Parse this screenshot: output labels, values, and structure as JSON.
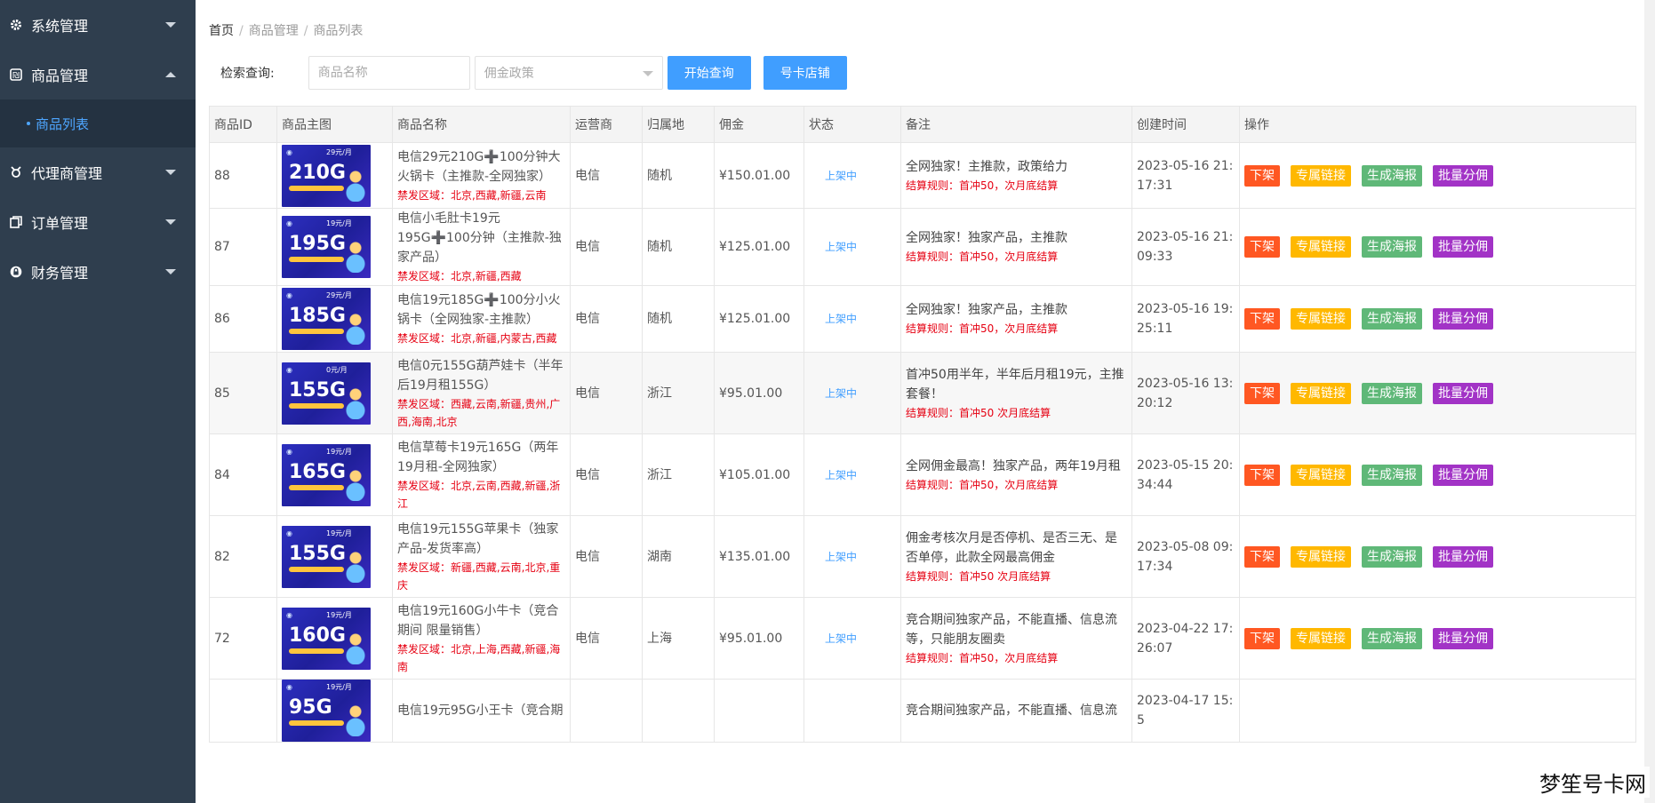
{
  "sidebar": {
    "items": [
      {
        "label": "系统管理",
        "icon": "gear-icon",
        "expanded": false
      },
      {
        "label": "商品管理",
        "icon": "goods-icon",
        "expanded": true
      },
      {
        "label": "代理商管理",
        "icon": "agent-icon",
        "expanded": false
      },
      {
        "label": "订单管理",
        "icon": "order-icon",
        "expanded": false
      },
      {
        "label": "财务管理",
        "icon": "lock-icon",
        "expanded": false
      }
    ],
    "sub_item": "商品列表"
  },
  "breadcrumb": [
    "首页",
    "商品管理",
    "商品列表"
  ],
  "search": {
    "label": "检索查询:",
    "name_placeholder": "商品名称",
    "policy_placeholder": "佣金政策",
    "query_button": "开始查询",
    "shop_button": "号卡店铺"
  },
  "table": {
    "headers": [
      "商品ID",
      "商品主图",
      "商品名称",
      "运营商",
      "归属地",
      "佣金",
      "状态",
      "备注",
      "创建时间",
      "操作"
    ],
    "actions": [
      "下架",
      "专属链接",
      "生成海报",
      "批量分佣"
    ],
    "rows": [
      {
        "id": "88",
        "img_big": "210G",
        "img_price": "29元/月",
        "name": "电信29元210G➕100分钟大火锅卡（主推款-全网独家）",
        "ban": "禁发区域：北京,西藏,新疆,云南",
        "operator": "电信",
        "region": "随机",
        "commission": "¥150.01.00",
        "status": "上架中",
        "remark": "全网独家！主推款，政策给力",
        "rule": "结算规则：首冲50，次月底结算",
        "time": "2023-05-16 21:17:31",
        "alt": false
      },
      {
        "id": "87",
        "img_big": "195G",
        "img_price": "19元/月",
        "name": "电信小毛肚卡19元195G➕100分钟（主推款-独家产品）",
        "ban": "禁发区域：北京,新疆,西藏",
        "operator": "电信",
        "region": "随机",
        "commission": "¥125.01.00",
        "status": "上架中",
        "remark": "全网独家！独家产品，主推款",
        "rule": "结算规则：首冲50，次月底结算",
        "time": "2023-05-16 21:09:33",
        "alt": false
      },
      {
        "id": "86",
        "img_big": "185G",
        "img_price": "29元/月",
        "name": "电信19元185G➕100分小火锅卡（全网独家-主推款）",
        "ban": "禁发区域：北京,新疆,内蒙古,西藏",
        "operator": "电信",
        "region": "随机",
        "commission": "¥125.01.00",
        "status": "上架中",
        "remark": "全网独家！独家产品，主推款",
        "rule": "结算规则：首冲50，次月底结算",
        "time": "2023-05-16 19:25:11",
        "alt": false
      },
      {
        "id": "85",
        "img_big": "155G",
        "img_price": "0元/月",
        "name": "电信0元155G葫芦娃卡（半年后19月租155G）",
        "ban": "禁发区域：西藏,云南,新疆,贵州,广西,海南,北京",
        "operator": "电信",
        "region": "浙江",
        "commission": "¥95.01.00",
        "status": "上架中",
        "remark": "首冲50用半年，半年后月租19元，主推套餐！",
        "rule": "结算规则：首冲50 次月底结算",
        "time": "2023-05-16 13:20:12",
        "alt": true
      },
      {
        "id": "84",
        "img_big": "165G",
        "img_price": "19元/月",
        "name": "电信草莓卡19元165G（两年19月租-全网独家）",
        "ban": "禁发区域：北京,云南,西藏,新疆,浙江",
        "operator": "电信",
        "region": "浙江",
        "commission": "¥105.01.00",
        "status": "上架中",
        "remark": "全网佣金最高！独家产品，两年19月租",
        "rule": "结算规则：首冲50，次月底结算",
        "time": "2023-05-15 20:34:44",
        "alt": false
      },
      {
        "id": "82",
        "img_big": "155G",
        "img_price": "19元/月",
        "name": "电信19元155G苹果卡（独家产品-发货率高）",
        "ban": "禁发区域：新疆,西藏,云南,北京,重庆",
        "operator": "电信",
        "region": "湖南",
        "commission": "¥135.01.00",
        "status": "上架中",
        "remark": "佣金考核次月是否停机、是否三无、是否单停，此款全网最高佣金",
        "rule": "结算规则：首冲50 次月底结算",
        "time": "2023-05-08 09:17:34",
        "alt": false
      },
      {
        "id": "72",
        "img_big": "160G",
        "img_price": "19元/月",
        "name": "电信19元160G小牛卡（竞合期间 限量销售）",
        "ban": "禁发区域：北京,上海,西藏,新疆,海南",
        "operator": "电信",
        "region": "上海",
        "commission": "¥95.01.00",
        "status": "上架中",
        "remark": "竞合期间独家产品，不能直播、信息流等，只能朋友圈卖",
        "rule": "结算规则：首冲50，次月底结算",
        "time": "2023-04-22 17:26:07",
        "alt": false
      },
      {
        "id": "",
        "img_big": "95G",
        "img_price": "19元/月",
        "name": "电信19元95G小王卡（竞合期",
        "ban": "",
        "operator": "",
        "region": "",
        "commission": "",
        "status": "",
        "remark": "竞合期间独家产品，不能直播、信息流",
        "rule": "",
        "time": "2023-04-17 15:5",
        "alt": false
      }
    ]
  },
  "watermark": "梦笙号卡网",
  "colors": {
    "sidebar_bg": "#2f3e4e",
    "accent_blue": "#409eff",
    "ban_red": "#e60012",
    "op_red": "#ff5722",
    "op_orange": "#ffb800",
    "op_green": "#5fb878",
    "op_purple": "#a233c6"
  }
}
